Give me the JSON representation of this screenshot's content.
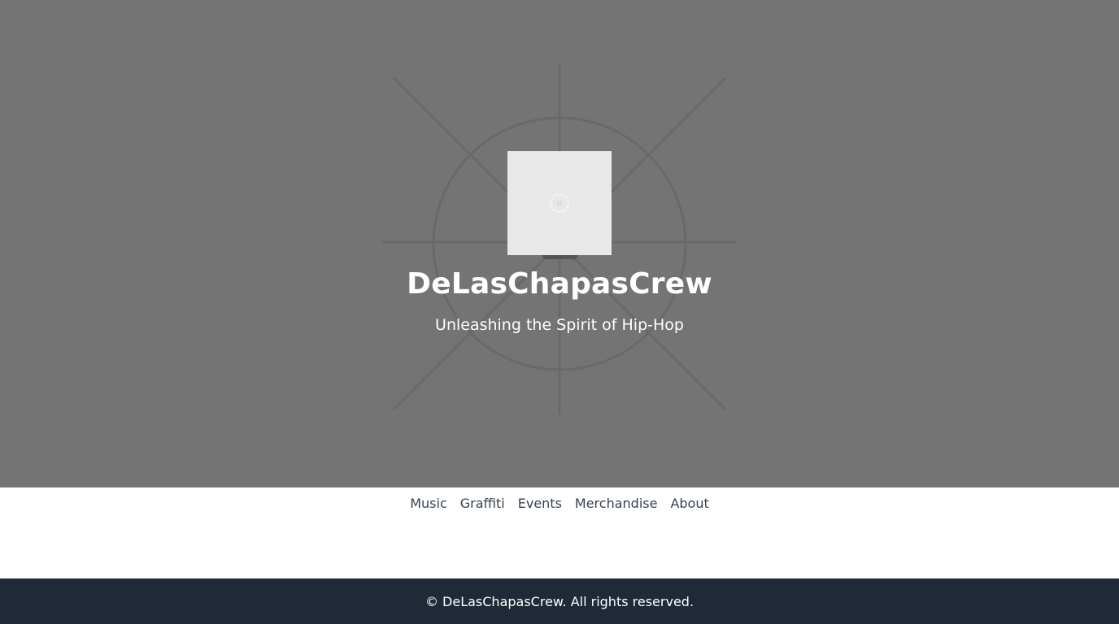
{
  "hero": {
    "title": "DeLasChapasCrew",
    "tagline": "Unleashing the Spirit of Hip-Hop",
    "background_color": "#747474",
    "logo_icon": "loading-spinner-icon"
  },
  "nav": {
    "items": [
      {
        "label": "Music"
      },
      {
        "label": "Graffiti"
      },
      {
        "label": "Events"
      },
      {
        "label": "Merchandise"
      },
      {
        "label": "About"
      }
    ]
  },
  "footer": {
    "copyright": "© DeLasChapasCrew. All rights reserved.",
    "background_color": "#1f2937"
  }
}
